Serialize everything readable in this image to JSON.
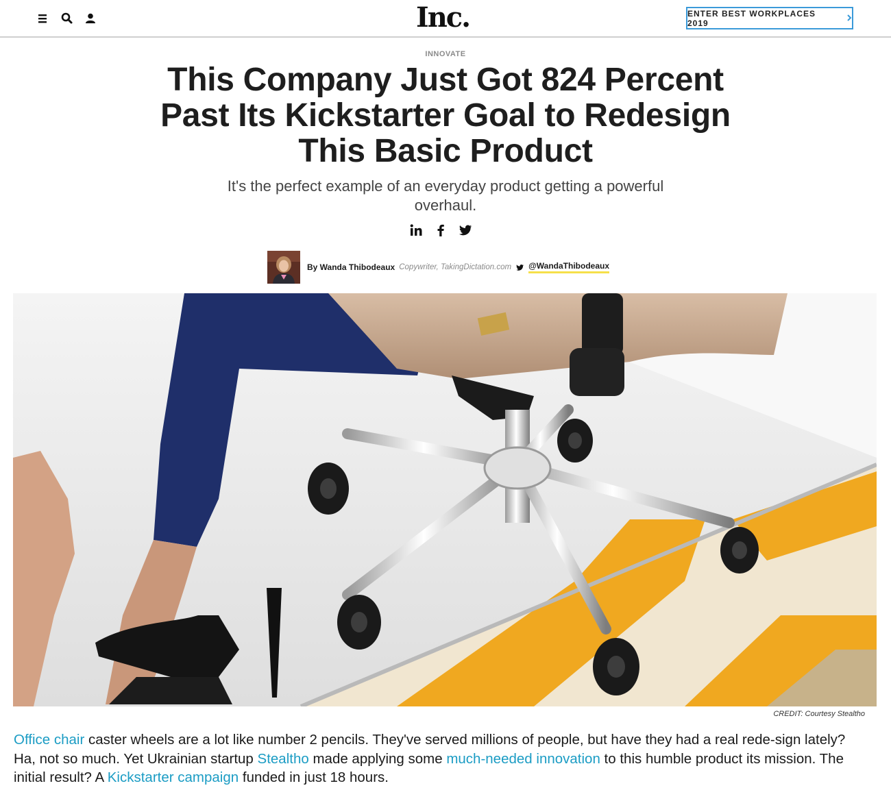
{
  "header": {
    "logo": "Inc.",
    "cta_label": "ENTER BEST WORKPLACES 2019",
    "cta_icon": "chevron-right-icon",
    "icons": [
      "menu-icon",
      "search-icon",
      "user-icon"
    ],
    "accent_color": "#3a9ad9"
  },
  "article": {
    "section": "INNOVATE",
    "headline": "This Company Just Got 824 Percent Past Its Kickstarter Goal to Redesign This Basic Product",
    "dek": "It's the perfect example of an everyday product getting a powerful overhaul.",
    "share_icons": [
      "linkedin-icon",
      "facebook-icon",
      "twitter-icon"
    ],
    "byline": {
      "author": "By Wanda Thibodeaux",
      "title": "Copywriter, TakingDictation.com",
      "twitter_handle": "@WandaThibodeaux"
    },
    "image_credit": "CREDIT: Courtesy Stealtho",
    "body": {
      "link1": "Office chair",
      "t1": " caster wheels are a lot like number 2 pencils. They've served millions of people, but have they had a real rede-sign lately? Ha, not so much. Yet Ukrainian startup ",
      "link2": "Stealtho",
      "t2": " made applying some ",
      "link3": "much-needed innovation",
      "t3": " to this humble product its mission. The initial result? A ",
      "link4": "Kickstarter campaign",
      "t4": " funded in just 18 hours."
    },
    "link_color": "#1b9cc4"
  }
}
